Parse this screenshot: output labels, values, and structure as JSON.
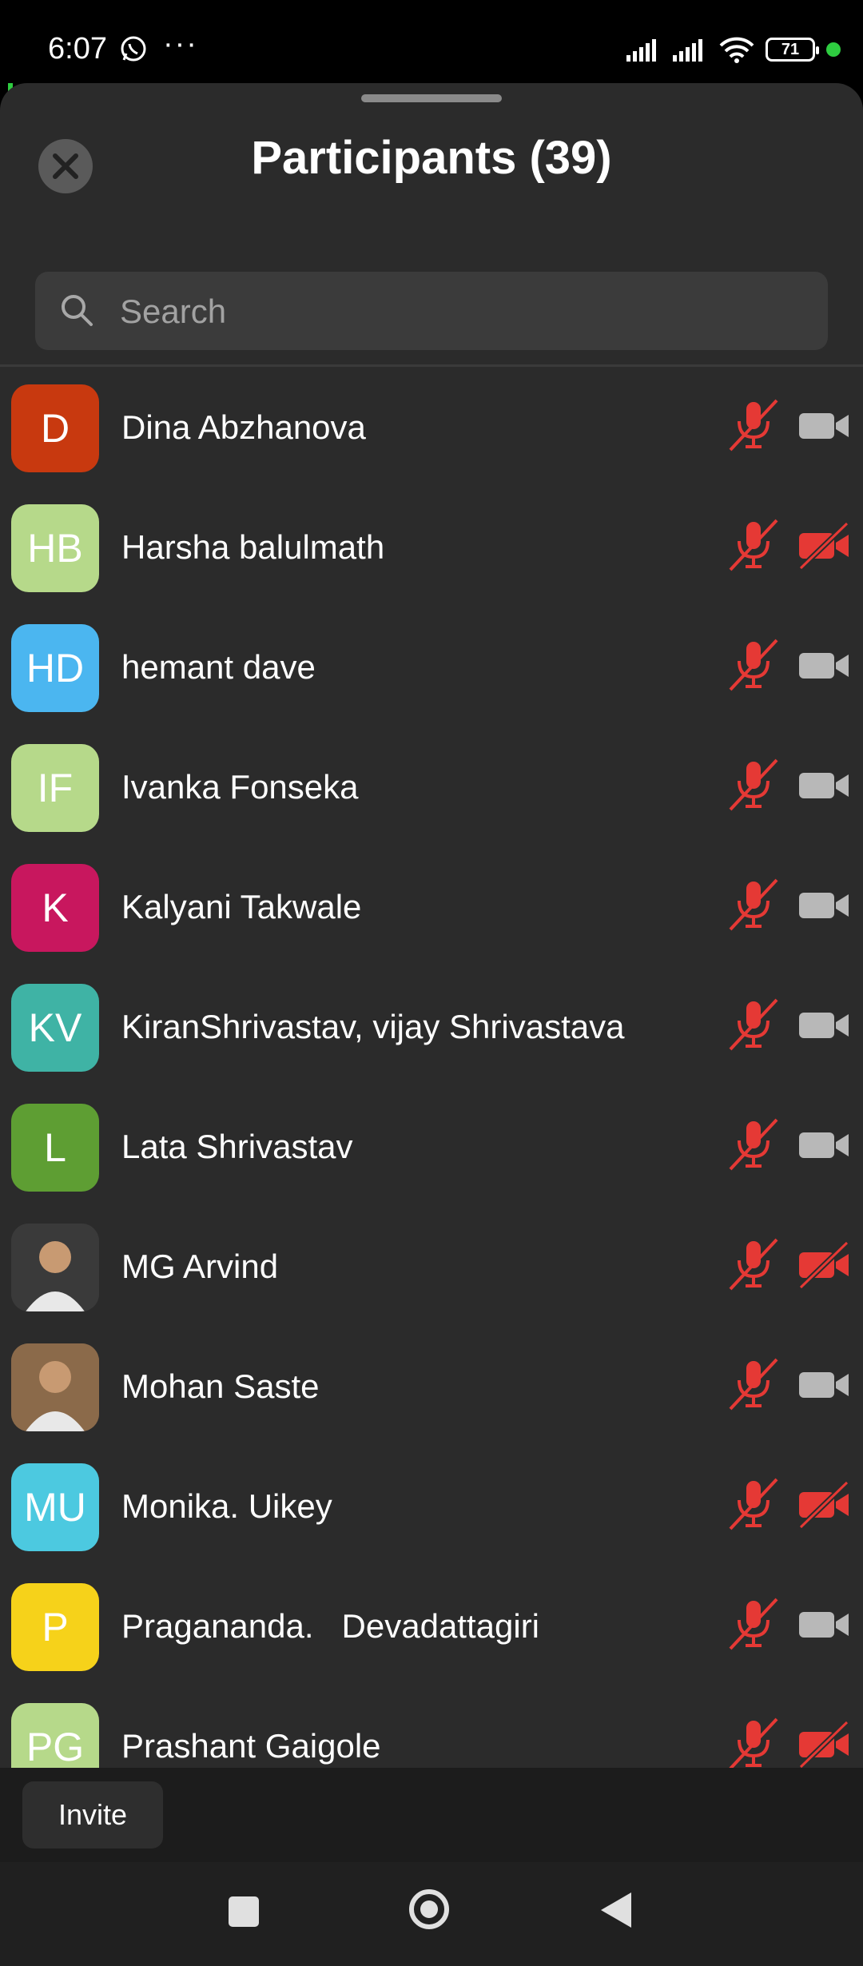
{
  "status": {
    "time": "6:07",
    "dots": "···",
    "battery": "71"
  },
  "header": {
    "title": "Participants (39)"
  },
  "search": {
    "placeholder": "Search"
  },
  "participants": [
    {
      "initials": "D",
      "name": "Dina Abzhanova",
      "color": "#c8390f",
      "mic_muted": true,
      "video_off": false
    },
    {
      "initials": "HB",
      "name": "Harsha balulmath",
      "color": "#b6d98a",
      "mic_muted": true,
      "video_off": true
    },
    {
      "initials": "HD",
      "name": "hemant dave",
      "color": "#4bb6f0",
      "mic_muted": true,
      "video_off": false
    },
    {
      "initials": "IF",
      "name": "Ivanka Fonseka",
      "color": "#b6d98a",
      "mic_muted": true,
      "video_off": false
    },
    {
      "initials": "K",
      "name": "Kalyani Takwale",
      "color": "#c8175e",
      "mic_muted": true,
      "video_off": false
    },
    {
      "initials": "KV",
      "name": "KiranShrivastav, vijay Shrivastava",
      "color": "#3fb3a5",
      "mic_muted": true,
      "video_off": false
    },
    {
      "initials": "L",
      "name": "Lata Shrivastav",
      "color": "#5e9e33",
      "mic_muted": true,
      "video_off": false
    },
    {
      "initials": "",
      "name": "MG Arvind",
      "color": "#3a3a3a",
      "photo": true,
      "mic_muted": true,
      "video_off": true
    },
    {
      "initials": "",
      "name": "Mohan Saste",
      "color": "#8b6a4a",
      "photo": true,
      "mic_muted": true,
      "video_off": false
    },
    {
      "initials": "MU",
      "name": "Monika. Uikey",
      "color": "#4cc9e0",
      "mic_muted": true,
      "video_off": true
    },
    {
      "initials": "P",
      "name": "Pragananda.   Devadattagiri",
      "color": "#f6d21a",
      "mic_muted": true,
      "video_off": false
    },
    {
      "initials": "PG",
      "name": "Prashant Gaigole",
      "color": "#b6d98a",
      "mic_muted": true,
      "video_off": true
    }
  ],
  "footer": {
    "invite_label": "Invite"
  },
  "colors": {
    "muted_red": "#e53935",
    "cam_gray": "#b8b8b8",
    "sheet_bg": "#2b2b2b"
  }
}
